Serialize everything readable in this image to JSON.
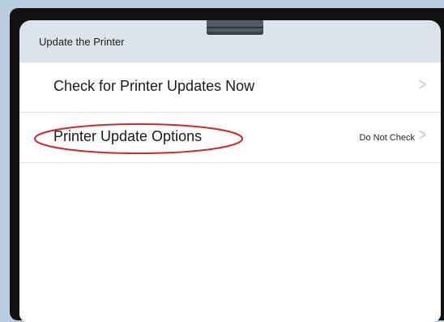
{
  "screen": {
    "title": "Update the Printer"
  },
  "menu": {
    "items": [
      {
        "label": "Check for Printer Updates Now",
        "value": ""
      },
      {
        "label": "Printer Update Options",
        "value": "Do Not Check"
      }
    ]
  },
  "icons": {
    "chevron": ">"
  },
  "colors": {
    "page_background": "#b9cde0",
    "bezel": "#111111",
    "screen_header": "#dde3ea",
    "highlight": "#cc2a2a"
  }
}
